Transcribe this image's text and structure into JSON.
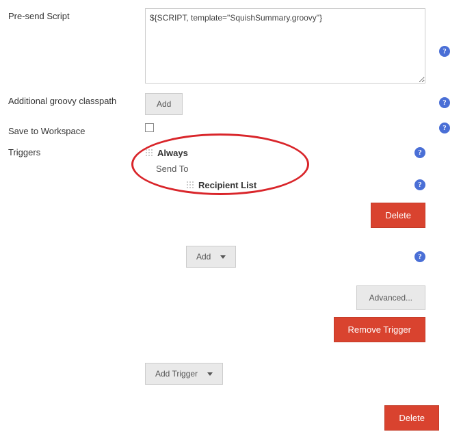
{
  "fields": {
    "presend_label": "Pre-send Script",
    "presend_value": "${SCRIPT, template=\"SquishSummary.groovy\"}",
    "classpath_label": "Additional groovy classpath",
    "save_ws_label": "Save to Workspace",
    "triggers_label": "Triggers"
  },
  "buttons": {
    "add": "Add",
    "delete": "Delete",
    "advanced": "Advanced...",
    "remove_trigger": "Remove Trigger",
    "add_trigger": "Add Trigger"
  },
  "trigger": {
    "name": "Always",
    "send_to_label": "Send To",
    "recipient": "Recipient List"
  },
  "help_glyph": "?"
}
